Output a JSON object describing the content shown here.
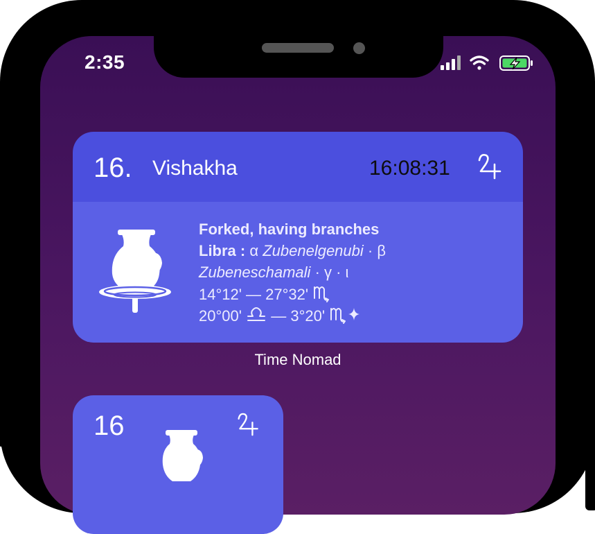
{
  "status_bar": {
    "time": "2:35"
  },
  "widget_medium": {
    "number": "16.",
    "nakshatra_name": "Vishakha",
    "time": "16:08:31",
    "planet_icon": "jupiter-symbol-icon",
    "symbol_icon": "potters-wheel-icon",
    "meaning": "Forked, having branches",
    "sign": "Libra :",
    "star_line_1_alpha": "α",
    "star_line_1_alpha_name": "Zubenelgenubi",
    "star_line_1_sep": "·",
    "star_line_1_beta": "β",
    "star_line_2_beta_name": "Zubeneschamali",
    "star_line_2_rest": "· γ · ι",
    "range_1": "14°12' — 27°32'",
    "range_1_sign_icon": "scorpio-icon",
    "range_2_start": "20°00'",
    "range_2_start_sign_icon": "libra-icon",
    "range_2_dash": "—",
    "range_2_end": "3°20'",
    "range_2_end_sign_icon": "scorpio-sparkle-icon"
  },
  "widget_caption": "Time Nomad",
  "widget_small": {
    "number": "16",
    "planet_icon": "jupiter-symbol-icon",
    "symbol_icon": "potters-wheel-icon"
  },
  "colors": {
    "widget_header": "#4b4fde",
    "widget_body": "#5b60e6",
    "background_top": "#3a0f55",
    "background_bottom": "#5a1f64",
    "battery_green": "#4cd964"
  }
}
